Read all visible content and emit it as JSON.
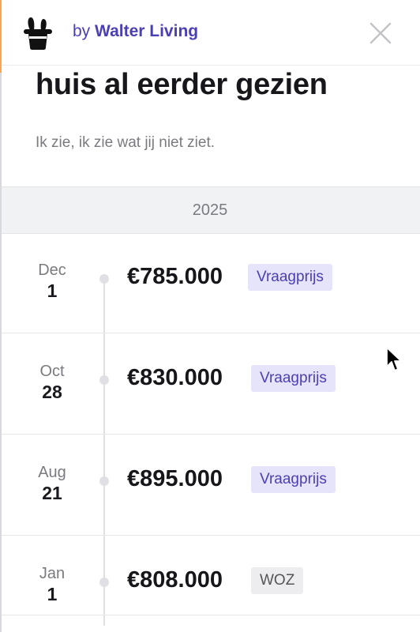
{
  "header": {
    "logo_icon": "magic-hat-icon",
    "by_prefix": "by",
    "brand_name": "Walter Living",
    "close_icon": "close-icon",
    "accent_color": "#4a3fb5"
  },
  "intro": {
    "title": "huis al eerder gezien",
    "subtitle": "Ik zie, ik zie wat jij niet ziet."
  },
  "timeline": {
    "year": "2025",
    "entries": [
      {
        "month": "Dec",
        "day": "1",
        "price": "€785.000",
        "type": "Vraagprijs"
      },
      {
        "month": "Oct",
        "day": "28",
        "price": "€830.000",
        "type": "Vraagprijs"
      },
      {
        "month": "Aug",
        "day": "21",
        "price": "€895.000",
        "type": "Vraagprijs"
      },
      {
        "month": "Jan",
        "day": "1",
        "price": "€808.000",
        "type": "WOZ"
      }
    ]
  },
  "colors": {
    "tag_ask_bg": "#e6e4fa",
    "tag_ask_text": "#4a3fb5",
    "tag_woz_bg": "#ededef",
    "tag_woz_text": "#55555a"
  }
}
